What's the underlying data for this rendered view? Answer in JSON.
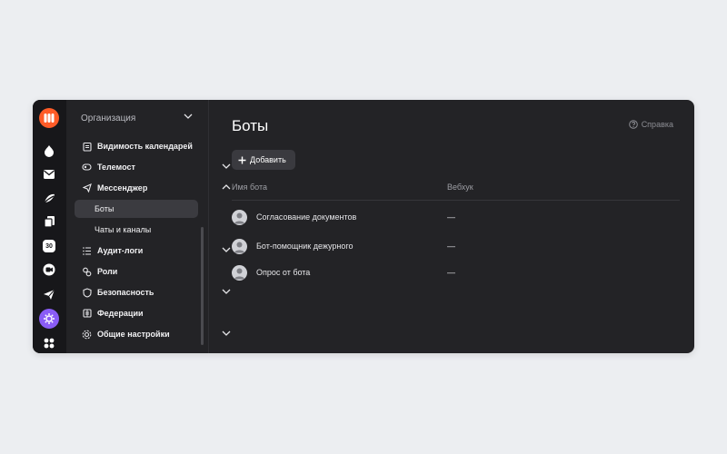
{
  "rail": {
    "items": [
      "logo-icon",
      "drop-icon",
      "mail-icon",
      "disk-icon",
      "docs-icon",
      "calendar-icon",
      "telemost-icon",
      "messenger-icon",
      "admin-icon",
      "apps-icon"
    ],
    "calendar_day": "30",
    "accent": "#ff5c28",
    "active_bg": "#8a5cf6"
  },
  "sidebar": {
    "org_label": "Организация",
    "items": [
      {
        "label": "Видимость календарей",
        "icon": "calendar-list-icon"
      },
      {
        "label": "Телемост",
        "icon": "telemost-small-icon"
      },
      {
        "label": "Мессенджер",
        "icon": "messenger-small-icon"
      },
      {
        "label": "Боты"
      },
      {
        "label": "Чаты и каналы"
      },
      {
        "label": "Аудит-логи",
        "icon": "list-icon"
      },
      {
        "label": "Роли",
        "icon": "roles-icon"
      },
      {
        "label": "Безопасность",
        "icon": "shield-icon"
      },
      {
        "label": "Федерации",
        "icon": "federation-icon"
      },
      {
        "label": "Общие настройки",
        "icon": "gear-icon"
      }
    ]
  },
  "main": {
    "title": "Боты",
    "help_label": "Справка",
    "add_label": "Добавить",
    "columns": {
      "name": "Имя бота",
      "webhook": "Вебхук"
    },
    "rows": [
      {
        "name": "Согласование документов",
        "webhook": "—"
      },
      {
        "name": "Бот-помощник дежурного",
        "webhook": "—"
      },
      {
        "name": "Опрос от бота",
        "webhook": "—"
      }
    ]
  }
}
